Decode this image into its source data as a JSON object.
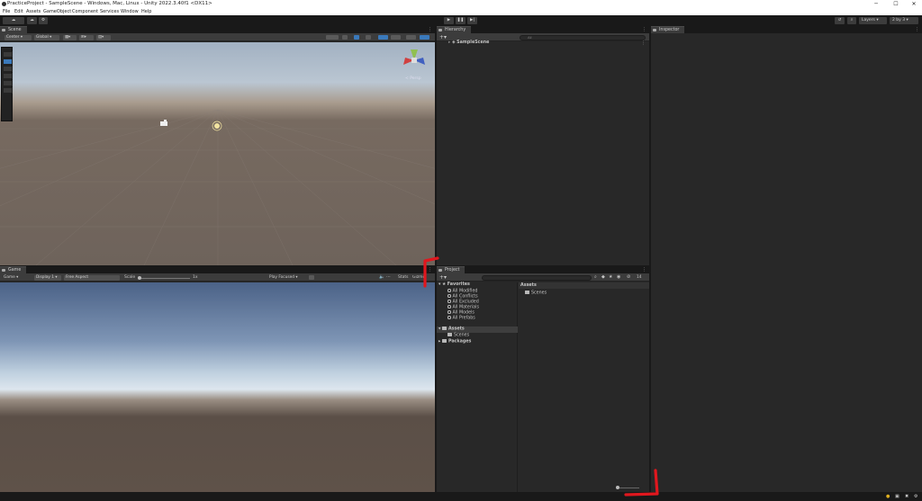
{
  "window": {
    "title": "PracticeProject - SampleScene - Windows, Mac, Linux - Unity 2022.3.40f1 <DX11>",
    "minimize": "─",
    "maximize": "☐",
    "close": "✕"
  },
  "menu": [
    "File",
    "Edit",
    "Assets",
    "GameObject",
    "Component",
    "Services",
    "Window",
    "Help"
  ],
  "toolbar": {
    "account": "☁",
    "play": "▶",
    "pause": "❚❚",
    "step": "▶|",
    "layers": "Layers",
    "layout": "2 by 3"
  },
  "scene": {
    "tab": "Scene",
    "pivot": "Center",
    "space": "Global",
    "gizmo_label": "< Persp"
  },
  "game": {
    "tab": "Game",
    "mode": "Game",
    "display": "Display 1",
    "aspect": "Free Aspect",
    "scale_label": "Scale",
    "scale_value": "1x",
    "play_mode": "Play Focused",
    "stats": "Stats",
    "gizmos": "Gizmos"
  },
  "hierarchy": {
    "tab": "Hierarchy",
    "search_placeholder": "All",
    "scene_name": "SampleScene"
  },
  "project": {
    "tab": "Project",
    "badge": "14",
    "favorites": "Favorites",
    "fav_items": [
      "All Modified",
      "All Conflicts",
      "All Excluded",
      "All Materials",
      "All Models",
      "All Prefabs"
    ],
    "assets": "Assets",
    "asset_children": [
      "Scenes"
    ],
    "packages": "Packages",
    "breadcrumb": "Assets",
    "grid_items": [
      "Scenes"
    ]
  },
  "inspector": {
    "tab": "Inspector"
  },
  "colors": {
    "accent": "#3a79bb",
    "panel": "#282828",
    "annotation": "#e0171e"
  }
}
